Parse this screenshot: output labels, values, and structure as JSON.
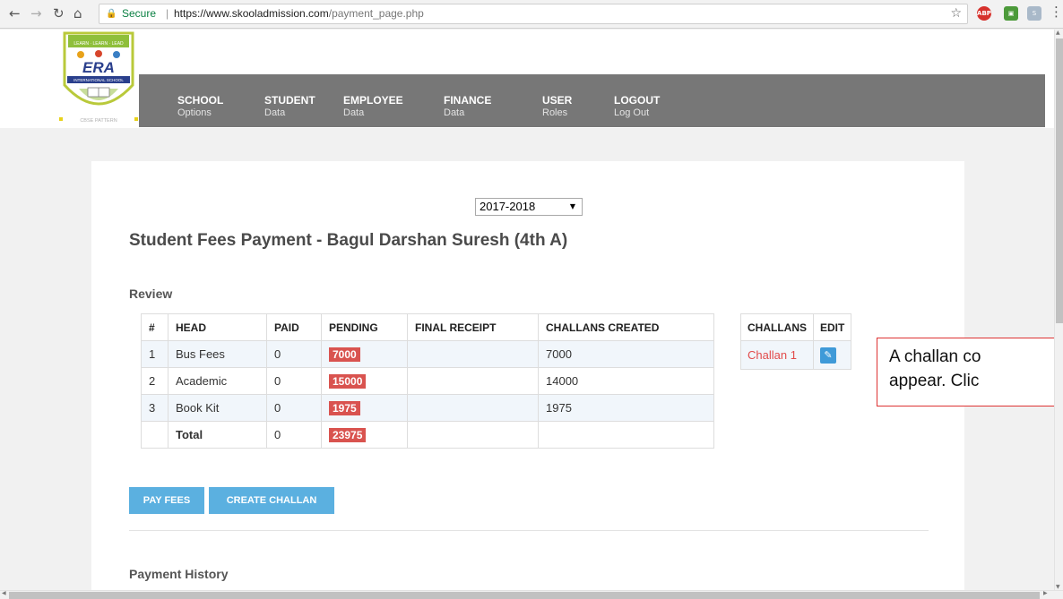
{
  "browser": {
    "secure_label": "Secure",
    "url_host": "https://www.skooladmission.com",
    "url_path": "/payment_page.php",
    "ext_abp_label": "ABP",
    "icons": [
      "back-icon",
      "forward-icon",
      "reload-icon",
      "home-icon",
      "lock-icon",
      "star-icon",
      "adblock-icon",
      "extension-icon",
      "skype-icon",
      "menu-icon"
    ]
  },
  "logo": {
    "name": "ERA",
    "subtitle": "INTERNATIONAL SCHOOL",
    "pattern": "CBSE PATTERN"
  },
  "nav": [
    {
      "title": "SCHOOL",
      "sub": "Options"
    },
    {
      "title": "STUDENT",
      "sub": "Data"
    },
    {
      "title": "EMPLOYEE",
      "sub": "Data"
    },
    {
      "title": "FINANCE",
      "sub": "Data"
    },
    {
      "title": "USER",
      "sub": "Roles"
    },
    {
      "title": "LOGOUT",
      "sub": "Log Out"
    }
  ],
  "year": {
    "selected": "2017-2018"
  },
  "title": "Student Fees Payment - Bagul Darshan Suresh (4th A)",
  "review": {
    "label": "Review",
    "columns": [
      "#",
      "HEAD",
      "PAID",
      "PENDING",
      "FINAL RECEIPT",
      "CHALLANS CREATED"
    ],
    "rows": [
      {
        "num": "1",
        "head": "Bus Fees",
        "paid": "0",
        "pending": "7000",
        "final_receipt": "",
        "challans_created": "7000"
      },
      {
        "num": "2",
        "head": "Academic",
        "paid": "0",
        "pending": "15000",
        "final_receipt": "",
        "challans_created": "14000"
      },
      {
        "num": "3",
        "head": "Book Kit",
        "paid": "0",
        "pending": "1975",
        "final_receipt": "",
        "challans_created": "1975"
      }
    ],
    "total": {
      "label": "Total",
      "paid": "0",
      "pending": "23975"
    }
  },
  "challans": {
    "columns": [
      "CHALLANS",
      "EDIT"
    ],
    "rows": [
      {
        "name": "Challan 1"
      }
    ]
  },
  "buttons": {
    "pay_fees": "PAY FEES",
    "create_challan": "CREATE CHALLAN"
  },
  "payment_history": {
    "label": "Payment History"
  },
  "annotation": {
    "line1": "A challan co",
    "line2": "appear. Clic"
  },
  "colors": {
    "navbar": "#777777",
    "badge": "#d9534f",
    "button": "#5bb0e0",
    "link": "#e24b4b",
    "annotation_border": "#dd3333"
  }
}
